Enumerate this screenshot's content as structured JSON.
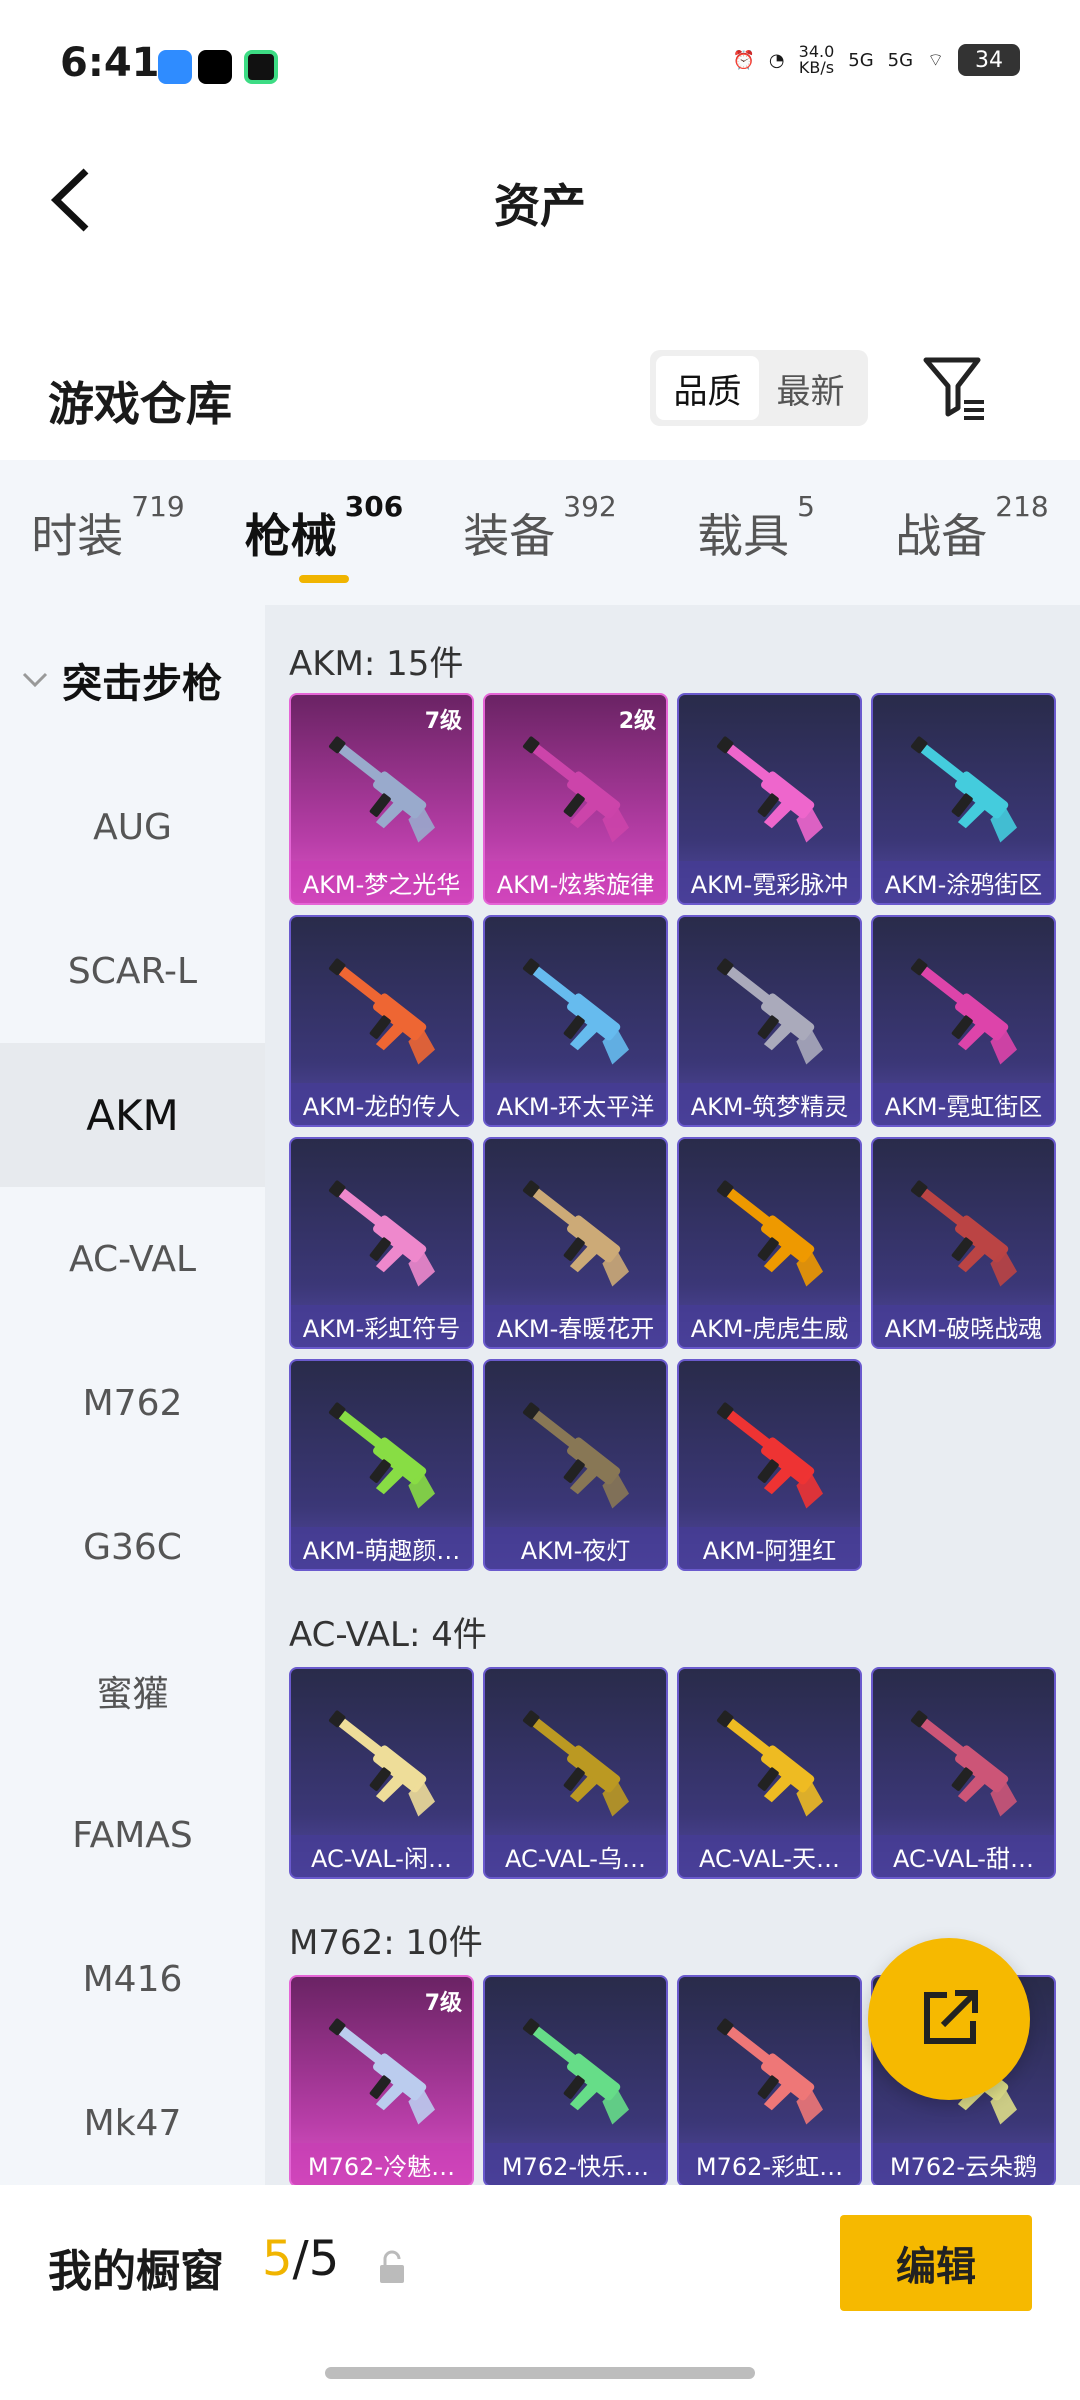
{
  "status": {
    "time": "6:41",
    "net_speed": "34.0\nKB/s",
    "sig1": "5G",
    "sig2": "5G",
    "battery": "34"
  },
  "header": {
    "title": "资产"
  },
  "section": {
    "title": "游戏仓库",
    "seg_quality": "品质",
    "seg_latest": "最新"
  },
  "tabs": [
    {
      "label": "时装",
      "count": "719"
    },
    {
      "label": "枪械",
      "count": "306"
    },
    {
      "label": "装备",
      "count": "392"
    },
    {
      "label": "载具",
      "count": "5"
    },
    {
      "label": "战备",
      "count": "218"
    }
  ],
  "sidebar": {
    "category": "突击步枪",
    "items": [
      "AUG",
      "SCAR-L",
      "AKM",
      "AC-VAL",
      "M762",
      "G36C",
      "蜜獾",
      "FAMAS",
      "M416",
      "Mk47"
    ]
  },
  "groups": [
    {
      "title": "AKM: 15件",
      "items": [
        {
          "name": "AKM-梦之光华",
          "level": "7级",
          "rarity": "pink",
          "gun": "#9ac"
        },
        {
          "name": "AKM-炫紫旋律",
          "level": "2级",
          "rarity": "pink",
          "gun": "#c4a"
        },
        {
          "name": "AKM-霓彩脉冲",
          "level": "",
          "rarity": "purple",
          "gun": "#e6c"
        },
        {
          "name": "AKM-涂鸦街区",
          "level": "",
          "rarity": "purple",
          "gun": "#4cd"
        },
        {
          "name": "AKM-龙的传人",
          "level": "",
          "rarity": "purple",
          "gun": "#e63"
        },
        {
          "name": "AKM-环太平洋",
          "level": "",
          "rarity": "purple",
          "gun": "#6be"
        },
        {
          "name": "AKM-筑梦精灵",
          "level": "",
          "rarity": "purple",
          "gun": "#aab"
        },
        {
          "name": "AKM-霓虹街区",
          "level": "",
          "rarity": "purple",
          "gun": "#d4a"
        },
        {
          "name": "AKM-彩虹符号",
          "level": "",
          "rarity": "purple",
          "gun": "#e8c"
        },
        {
          "name": "AKM-春暖花开",
          "level": "",
          "rarity": "purple",
          "gun": "#ca7"
        },
        {
          "name": "AKM-虎虎生威",
          "level": "",
          "rarity": "purple",
          "gun": "#e90"
        },
        {
          "name": "AKM-破晓战魂",
          "level": "",
          "rarity": "purple",
          "gun": "#b44"
        },
        {
          "name": "AKM-萌趣颜…",
          "level": "",
          "rarity": "purple",
          "gun": "#8d4"
        },
        {
          "name": "AKM-夜灯",
          "level": "",
          "rarity": "purple",
          "gun": "#875"
        },
        {
          "name": "AKM-阿狸红",
          "level": "",
          "rarity": "purple",
          "gun": "#e33"
        }
      ]
    },
    {
      "title": "AC-VAL: 4件",
      "items": [
        {
          "name": "AC-VAL-闲…",
          "level": "",
          "rarity": "purple",
          "gun": "#ed9"
        },
        {
          "name": "AC-VAL-乌…",
          "level": "",
          "rarity": "purple",
          "gun": "#b92"
        },
        {
          "name": "AC-VAL-天…",
          "level": "",
          "rarity": "purple",
          "gun": "#eb2"
        },
        {
          "name": "AC-VAL-甜…",
          "level": "",
          "rarity": "purple",
          "gun": "#c57"
        }
      ]
    },
    {
      "title": "M762: 10件",
      "items": [
        {
          "name": "M762-冷魅…",
          "level": "7级",
          "rarity": "pink",
          "gun": "#bce"
        },
        {
          "name": "M762-快乐…",
          "level": "",
          "rarity": "purple",
          "gun": "#6d8"
        },
        {
          "name": "M762-彩虹…",
          "level": "",
          "rarity": "purple",
          "gun": "#e77"
        },
        {
          "name": "M762-云朵鹅",
          "level": "",
          "rarity": "purple",
          "gun": "#dd8"
        }
      ]
    }
  ],
  "showcase": {
    "label": "我的橱窗",
    "current": "5",
    "sep": "/",
    "total": "5",
    "edit_label": "编辑"
  }
}
